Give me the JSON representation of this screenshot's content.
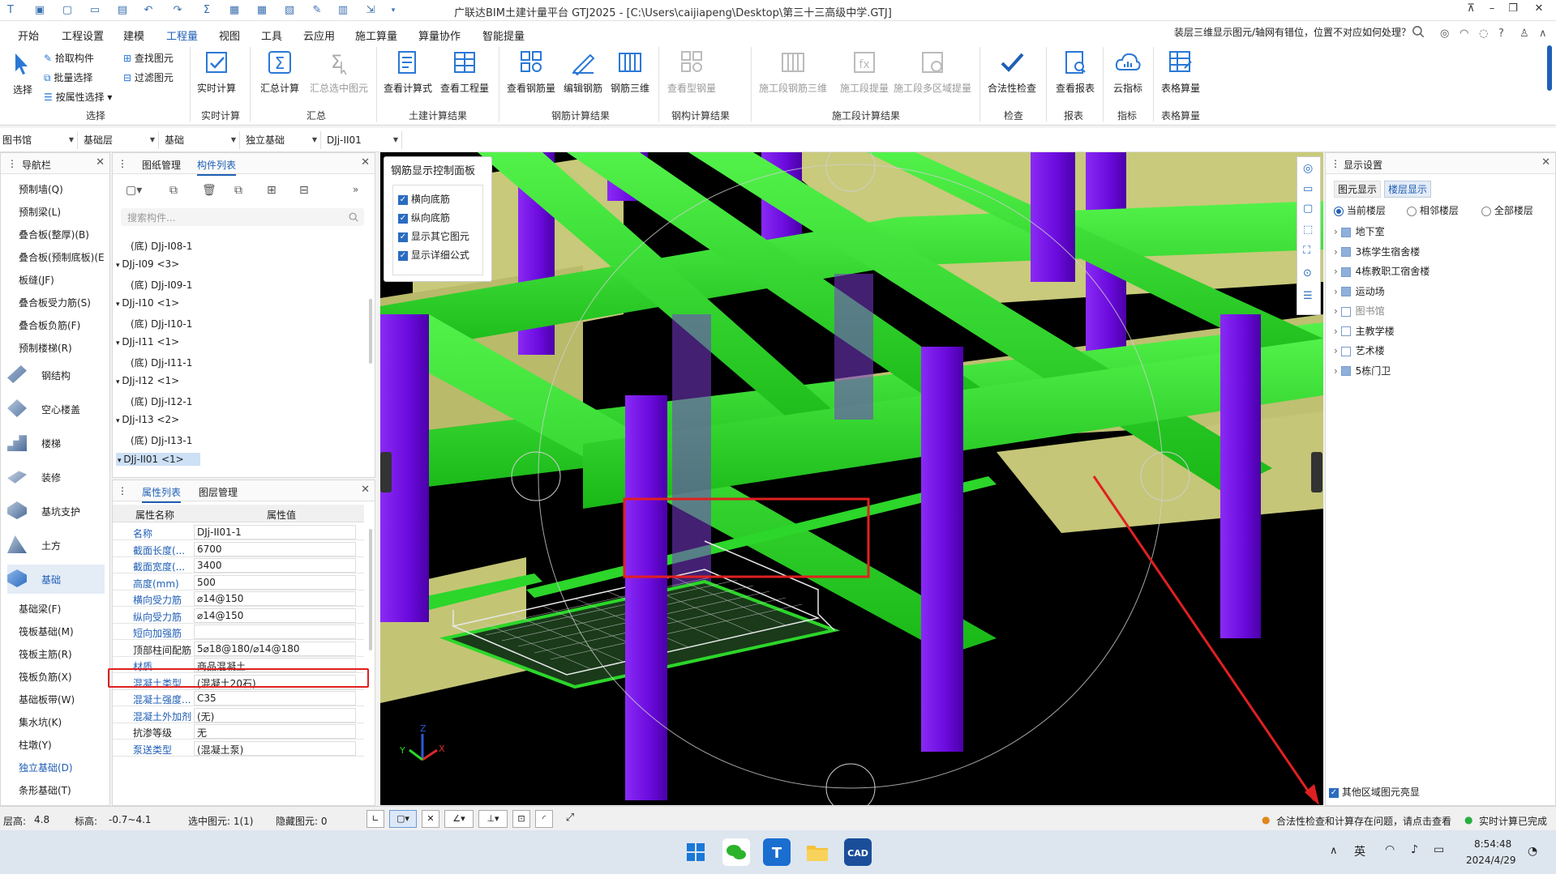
{
  "app": {
    "title": "广联达BIM土建计量平台 GTJ2025 - [C:\\Users\\caijiapeng\\Desktop\\第三十三高级中学.GTJ]"
  },
  "menu": [
    "开始",
    "工程设置",
    "建模",
    "工程量",
    "视图",
    "工具",
    "云应用",
    "施工算量",
    "算量协作",
    "智能提量"
  ],
  "menu_active": "工程量",
  "help_question": "装层三维显示图元/轴网有错位，位置不对应如何处理？",
  "ribbon": {
    "select": {
      "label": "选择",
      "pick": "拾取构件",
      "batch": "批量选择",
      "by_attr": "按属性选择"
    },
    "find": {
      "find": "查找图元",
      "filter": "过滤图元"
    },
    "realtime": {
      "label": "实时计算"
    },
    "summary": {
      "calc": "汇总计算",
      "calc_selected": "汇总选中图元"
    },
    "civil": {
      "formula": "查看计算式",
      "qty": "查看工程量"
    },
    "rebar": {
      "view": "查看钢筋量",
      "edit": "编辑钢筋",
      "three_d": "钢筋三维"
    },
    "steel": {
      "view": "查看型钢量"
    },
    "construction": {
      "c1": "施工段钢筋三维",
      "c2": "施工段提量",
      "c3": "施工段多区域提量"
    },
    "check": {
      "label": "合法性检查"
    },
    "report": {
      "label": "查看报表"
    },
    "cloud": {
      "label": "云指标"
    },
    "table": {
      "label": "表格算量"
    },
    "groups": [
      "选择",
      "实时计算",
      "汇总",
      "土建计算结果",
      "钢筋计算结果",
      "钢构计算结果",
      "施工段计算结果",
      "检查",
      "报表",
      "指标",
      "表格算量"
    ]
  },
  "combos": [
    "图书馆",
    "基础层",
    "基础",
    "独立基础",
    "DJj-II01"
  ],
  "nav": {
    "title": "导航栏",
    "items_top": [
      "预制墙(Q)",
      "预制梁(L)",
      "叠合板(整厚)(B)",
      "叠合板(预制底板)(E",
      "板缝(JF)",
      "叠合板受力筋(S)",
      "叠合板负筋(F)",
      "预制楼梯(R)"
    ],
    "big": [
      "钢结构",
      "空心楼盖",
      "楼梯",
      "装修",
      "基坑支护",
      "土方",
      "基础"
    ],
    "items_bottom": [
      "基础梁(F)",
      "筏板基础(M)",
      "筏板主筋(R)",
      "筏板负筋(X)",
      "基础板带(W)",
      "集水坑(K)",
      "柱墩(Y)",
      "独立基础(D)",
      "条形基础(T)"
    ]
  },
  "component_panel": {
    "tabs": [
      "图纸管理",
      "构件列表"
    ],
    "search_placeholder": "搜索构件...",
    "tree": [
      {
        "text": "(底) DJj-I08-1",
        "indent": 2
      },
      {
        "text": "DJj-I09 <3>",
        "indent": 1
      },
      {
        "text": "(底) DJj-I09-1",
        "indent": 2
      },
      {
        "text": "DJj-I10 <1>",
        "indent": 1
      },
      {
        "text": "(底) DJj-I10-1",
        "indent": 2
      },
      {
        "text": "DJj-I11 <1>",
        "indent": 1
      },
      {
        "text": "(底) DJj-I11-1",
        "indent": 2
      },
      {
        "text": "DJj-I12 <1>",
        "indent": 1
      },
      {
        "text": "(底) DJj-I12-1",
        "indent": 2
      },
      {
        "text": "DJj-I13 <2>",
        "indent": 1
      },
      {
        "text": "(底) DJj-I13-1",
        "indent": 2
      },
      {
        "text": "DJj-II01 <1>",
        "indent": 1
      }
    ]
  },
  "props_panel": {
    "tabs": [
      "属性列表",
      "图层管理"
    ],
    "col_name": "属性名称",
    "col_value": "属性值",
    "rows": [
      {
        "n": "名称",
        "v": "DJj-II01-1",
        "blue": true
      },
      {
        "n": "截面长度(...",
        "v": "6700",
        "blue": true
      },
      {
        "n": "截面宽度(...",
        "v": "3400",
        "blue": true
      },
      {
        "n": "高度(mm)",
        "v": "500",
        "blue": true
      },
      {
        "n": "横向受力筋",
        "v": "⌀14@150",
        "blue": true
      },
      {
        "n": "纵向受力筋",
        "v": "⌀14@150",
        "blue": true
      },
      {
        "n": "短向加强筋",
        "v": "",
        "blue": true
      },
      {
        "n": "顶部柱间配筋",
        "v": "5⌀18@180/⌀14@180",
        "blue": false
      },
      {
        "n": "材质",
        "v": "商品混凝土",
        "blue": true
      },
      {
        "n": "混凝土类型",
        "v": "(混凝土20石)",
        "blue": true
      },
      {
        "n": "混凝土强度...",
        "v": "C35",
        "blue": true
      },
      {
        "n": "混凝土外加剂",
        "v": "(无)",
        "blue": true
      },
      {
        "n": "抗渗等级",
        "v": "无",
        "blue": false
      },
      {
        "n": "泵送类型",
        "v": "(混凝土泵)",
        "blue": true
      }
    ]
  },
  "rebar_panel": {
    "title": "钢筋显示控制面板",
    "items": [
      "横向底筋",
      "纵向底筋",
      "显示其它图元",
      "显示详细公式"
    ]
  },
  "display_panel": {
    "title": "显示设置",
    "tabs": [
      "图元显示",
      "楼层显示"
    ],
    "radios": [
      "当前楼层",
      "相邻楼层",
      "全部楼层"
    ],
    "floors": [
      {
        "name": "地下室",
        "checked": true
      },
      {
        "name": "3栋学生宿舍楼",
        "checked": true
      },
      {
        "name": "4栋教职工宿舍楼",
        "checked": true
      },
      {
        "name": "运动场",
        "checked": true
      },
      {
        "name": "图书馆",
        "checked": false
      },
      {
        "name": "主教学楼",
        "checked": false
      },
      {
        "name": "艺术楼",
        "checked": false
      },
      {
        "name": "5栋门卫",
        "checked": true
      }
    ],
    "bottom_check": "其他区域图元亮显"
  },
  "status": {
    "floor_height": "层高:",
    "floor_height_val": "4.8",
    "elevation": "标高:",
    "elevation_val": "-0.7~4.1",
    "selected": "选中图元: 1(1)",
    "hidden": "隐藏图元: 0",
    "warning": "合法性检查和计算存在问题，请点击查看",
    "realtime": "实时计算已完成"
  },
  "taskbar": {
    "time": "8:54:48",
    "date": "2024/4/29",
    "ime": "英"
  },
  "colors": {
    "accent": "#1f5fb5",
    "beam": "#2ee02a",
    "column": "#7a12e8",
    "slab": "#c8c97a",
    "highlight": "#e02020"
  }
}
